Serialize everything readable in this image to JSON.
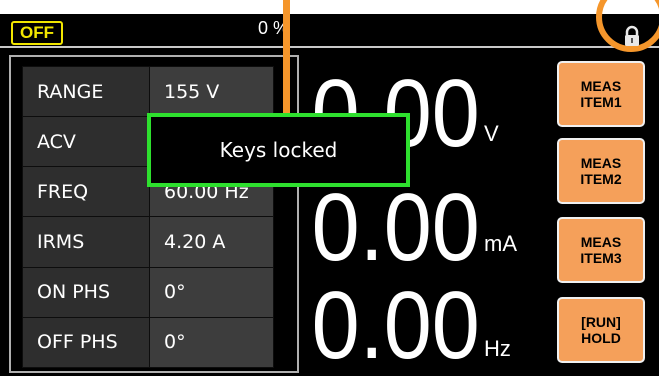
{
  "status": {
    "output_state": "OFF",
    "display_value": "0 %"
  },
  "params": [
    {
      "label": "RANGE",
      "value": "155 V"
    },
    {
      "label": "ACV",
      "value": ""
    },
    {
      "label": "FREQ",
      "value": "60.00 Hz"
    },
    {
      "label": "IRMS",
      "value": "4.20 A"
    },
    {
      "label": "ON PHS",
      "value": "0°"
    },
    {
      "label": "OFF PHS",
      "value": "0°"
    }
  ],
  "readouts": [
    {
      "value": "0.00",
      "unit": "V"
    },
    {
      "value": "0.00",
      "unit": "mA"
    },
    {
      "value": "0.00",
      "unit": "Hz"
    }
  ],
  "popup": {
    "message": "Keys locked"
  },
  "softkeys": [
    {
      "line1": "MEAS",
      "line2": "ITEM1"
    },
    {
      "line1": "MEAS",
      "line2": "ITEM2"
    },
    {
      "line1": "MEAS",
      "line2": "ITEM3"
    },
    {
      "line1": "[RUN]",
      "line2": "HOLD"
    }
  ],
  "colors": {
    "accent_orange": "#f5962b",
    "popup_border": "#2ee02e",
    "off_badge": "#f2e600",
    "softkey_fill": "#f5a05a"
  },
  "icons": {
    "lock": "lock-icon"
  }
}
